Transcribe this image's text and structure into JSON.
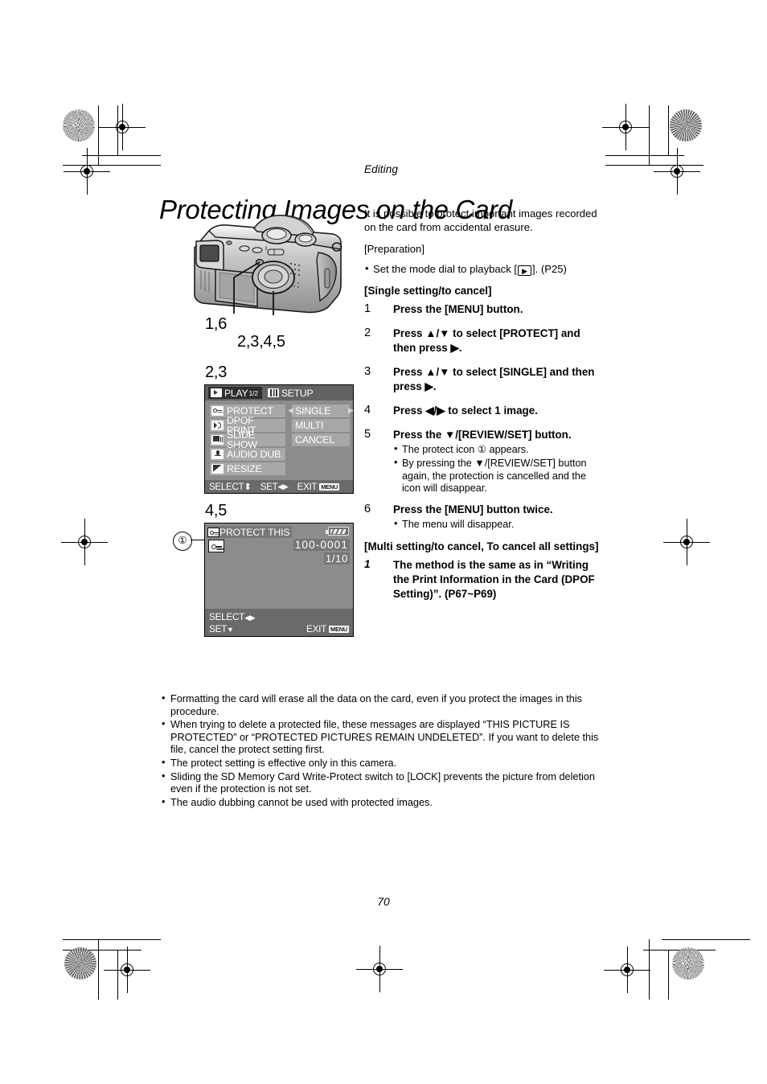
{
  "document": {
    "section_label": "Editing",
    "title": "Protecting Images on the Card",
    "page_number": "70"
  },
  "intro": {
    "paragraph": "It is possible to protect important images recorded on the card from accidental erasure.",
    "preparation_label": "[Preparation]",
    "preparation_bullet_before": "Set the mode dial to playback [",
    "preparation_bullet_after": "]. (P25)"
  },
  "single_section": {
    "heading": "[Single setting/to cancel]",
    "steps": [
      {
        "num": "1",
        "text": "Press the [MENU] button."
      },
      {
        "num": "2",
        "text": "Press ▲/▼ to select [PROTECT] and then press ▶."
      },
      {
        "num": "3",
        "text": "Press ▲/▼ to select [SINGLE] and then press ▶."
      },
      {
        "num": "4",
        "text": "Press ◀/▶ to select 1 image."
      },
      {
        "num": "5",
        "text": "Press the ▼/[REVIEW/SET] button."
      }
    ],
    "step5_subs": [
      "The protect icon ① appears.",
      "By pressing the ▼/[REVIEW/SET] button again, the protection is cancelled and the icon will disappear."
    ],
    "step6": {
      "num": "6",
      "text": "Press the [MENU] button twice."
    },
    "step6_sub": "The menu will disappear."
  },
  "multi_section": {
    "heading": "[Multi setting/to cancel, To cancel all settings]",
    "step": {
      "num": "1",
      "text": "The method is the same as in “Writing the Print Information in the Card (DPOF Setting)”. (P67~P69)"
    }
  },
  "camera_figure": {
    "label_menu_button": "1,6",
    "label_cursor_button": "2,3,4,5"
  },
  "lcd_menu": {
    "step_label": "2,3",
    "tabs": [
      {
        "label": "PLAY",
        "fraction": "1/2",
        "icon": "play-icon",
        "active": true
      },
      {
        "label": "SETUP",
        "fraction": "",
        "icon": "setup-icon",
        "active": false
      }
    ],
    "items": [
      {
        "label": "PROTECT",
        "icon": "key-icon"
      },
      {
        "label": "DPOF PRINT",
        "icon": "dpof-icon"
      },
      {
        "label": "SLIDE SHOW",
        "icon": "slideshow-icon"
      },
      {
        "label": "AUDIO DUB.",
        "icon": "microphone-icon"
      },
      {
        "label": "RESIZE",
        "icon": "resize-icon"
      }
    ],
    "options": [
      "SINGLE",
      "MULTI",
      "CANCEL"
    ],
    "selected_option": "SINGLE",
    "arrow_left": "◀",
    "arrow_right": "▶",
    "guide": {
      "select": "SELECT",
      "select_arrows": "⬍",
      "set": "SET",
      "set_arrows": "◀▶",
      "exit": "EXIT",
      "exit_badge": "MENU"
    }
  },
  "lcd_protect": {
    "step_label": "4,5",
    "title": "PROTECT THIS",
    "file_number": "100-0001",
    "frame_counter": "1/10",
    "callout_number": "①",
    "guide": {
      "select": "SELECT",
      "select_arrows": "◀▶",
      "set": "SET",
      "set_arrow": "▼",
      "exit": "EXIT",
      "exit_badge": "MENU"
    }
  },
  "notes": [
    "Formatting the card will erase all the data on the card, even if you protect the images in this procedure.",
    "When trying to delete a protected file, these messages are displayed “THIS PICTURE IS PROTECTED” or “PROTECTED PICTURES REMAIN UNDELETED”. If you want to delete this file, cancel the protect setting first.",
    "The protect setting is effective only in this camera.",
    "Sliding the SD Memory Card Write-Protect switch to [LOCK] prevents the picture from deletion even if the protection is not set.",
    "The audio dubbing cannot be used with protected images."
  ],
  "colors": {
    "lcd_background": "#8c8c8c",
    "lcd_tabbar": "#626262",
    "lcd_row": "#a8a8a8",
    "lcd_guide": "#6a6a6a",
    "text": "#000000"
  }
}
